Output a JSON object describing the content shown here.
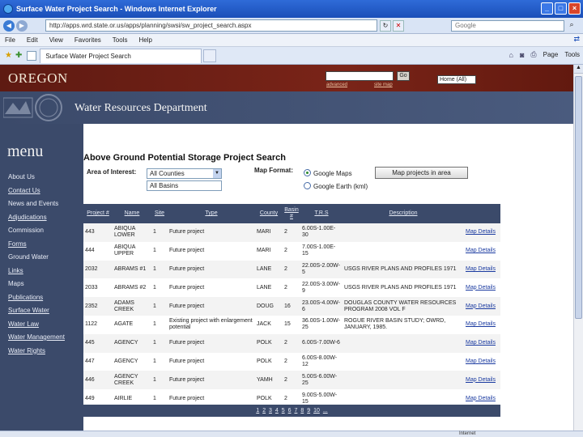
{
  "window": {
    "title": "Surface Water Project Search - Windows Internet Explorer",
    "url": "http://apps.wrd.state.or.us/apps/planning/swsi/sw_project_search.aspx",
    "search_placeholder": "Google"
  },
  "menubar": [
    "File",
    "Edit",
    "View",
    "Favorites",
    "Tools",
    "Help"
  ],
  "tab": {
    "label": "Surface Water Project Search"
  },
  "command_bar": {
    "page": "Page",
    "tools": "Tools"
  },
  "site": {
    "brand": "OREGON",
    "go_label": "Go",
    "advanced": "advanced",
    "site_map": "site map",
    "scope_select": "Home (All)",
    "department": "Water Resources Department"
  },
  "sidebar": {
    "title": "menu",
    "items": [
      {
        "label": "About Us",
        "link": false
      },
      {
        "label": "Contact Us",
        "link": true
      },
      {
        "label": "News and Events",
        "link": false
      },
      {
        "label": "Adjudications",
        "link": true
      },
      {
        "label": "Commission",
        "link": false
      },
      {
        "label": "Forms",
        "link": true
      },
      {
        "label": "Ground Water",
        "link": false
      },
      {
        "label": "Links",
        "link": true
      },
      {
        "label": "Maps",
        "link": false
      },
      {
        "label": "Publications",
        "link": true
      },
      {
        "label": "Surface Water",
        "link": true
      },
      {
        "label": "Water Law",
        "link": true
      },
      {
        "label": "Water Management",
        "link": true
      },
      {
        "label": "Water Rights",
        "link": true
      }
    ]
  },
  "search": {
    "title": "Above Ground Potential Storage Project Search",
    "area_label": "Area of Interest:",
    "county_select": "All Counties",
    "basin_select": "All Basins",
    "format_label": "Map Format:",
    "option_google_maps": "Google Maps",
    "option_google_earth": "Google Earth (kml)",
    "map_button": "Map projects in area"
  },
  "table": {
    "headers": [
      "Project #",
      "Name",
      "Site",
      "Type",
      "County",
      "Basin #",
      "T.R.S",
      "Description",
      ""
    ],
    "rows": [
      {
        "project": "443",
        "name": "ABIQUA LOWER",
        "site": "1",
        "type": "Future project",
        "county": "MARI",
        "basin": "2",
        "trs": "6.00S-1.00E-30",
        "description": "",
        "action": "Map Details"
      },
      {
        "project": "444",
        "name": "ABIQUA UPPER",
        "site": "1",
        "type": "Future project",
        "county": "MARI",
        "basin": "2",
        "trs": "7.00S-1.00E-15",
        "description": "",
        "action": "Map Details"
      },
      {
        "project": "2032",
        "name": "ABRAMS #1",
        "site": "1",
        "type": "Future project",
        "county": "LANE",
        "basin": "2",
        "trs": "22.00S-2.00W-5",
        "description": "USGS RIVER PLANS AND PROFILES 1971",
        "action": "Map Details"
      },
      {
        "project": "2033",
        "name": "ABRAMS #2",
        "site": "1",
        "type": "Future project",
        "county": "LANE",
        "basin": "2",
        "trs": "22.00S-3.00W-9",
        "description": "USGS RIVER PLANS AND PROFILES 1971",
        "action": "Map Details"
      },
      {
        "project": "2352",
        "name": "ADAMS CREEK",
        "site": "1",
        "type": "Future project",
        "county": "DOUG",
        "basin": "16",
        "trs": "23.00S-4.00W-6",
        "description": "DOUGLAS COUNTY WATER RESOURCES PROGRAM 2008 VOL F",
        "action": "Map Details"
      },
      {
        "project": "1122",
        "name": "AGATE",
        "site": "1",
        "type": "Existing project with enlargement potential",
        "county": "JACK",
        "basin": "15",
        "trs": "36.00S-1.00W-25",
        "description": "ROGUE RIVER BASIN STUDY; OWRD, JANUARY, 1985.",
        "action": "Map Details"
      },
      {
        "project": "445",
        "name": "AGENCY",
        "site": "1",
        "type": "Future project",
        "county": "POLK",
        "basin": "2",
        "trs": "6.00S-7.00W-6",
        "description": "",
        "action": "Map Details"
      },
      {
        "project": "447",
        "name": "AGENCY",
        "site": "1",
        "type": "Future project",
        "county": "POLK",
        "basin": "2",
        "trs": "6.00S-8.00W-12",
        "description": "",
        "action": "Map Details"
      },
      {
        "project": "446",
        "name": "AGENCY CREEK",
        "site": "1",
        "type": "Future project",
        "county": "YAMH",
        "basin": "2",
        "trs": "5.00S-6.00W-25",
        "description": "",
        "action": "Map Details"
      },
      {
        "project": "449",
        "name": "AIRLIE",
        "site": "1",
        "type": "Future project",
        "county": "POLK",
        "basin": "2",
        "trs": "9.00S-5.00W-15",
        "description": "",
        "action": "Map Details"
      }
    ],
    "pager": [
      "1",
      "2",
      "3",
      "4",
      "5",
      "6",
      "7",
      "8",
      "9",
      "10",
      "..."
    ]
  },
  "status": {
    "text": "Internet"
  }
}
